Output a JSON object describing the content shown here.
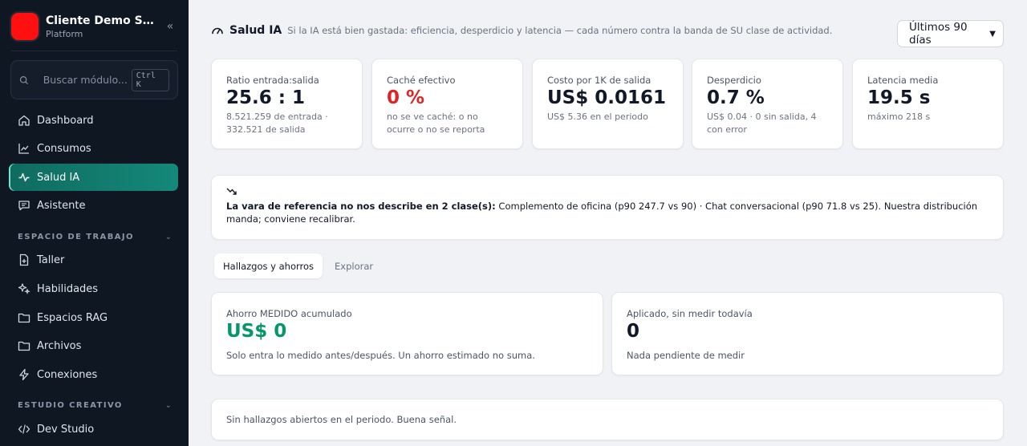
{
  "app": {
    "title": "Cliente Demo SI...",
    "subtitle": "Platform",
    "collapse_glyph": "«"
  },
  "search": {
    "placeholder": "Buscar módulo...",
    "shortcut": "Ctrl K"
  },
  "sidebar": {
    "items": [
      {
        "label": "Dashboard",
        "icon": "home-icon"
      },
      {
        "label": "Consumos",
        "icon": "line-chart-icon"
      },
      {
        "label": "Salud IA",
        "icon": "pulse-icon",
        "active": true
      },
      {
        "label": "Asistente",
        "icon": "chat-icon"
      }
    ],
    "sections": [
      {
        "label": "ESPACIO DE TRABAJO",
        "items": [
          {
            "label": "Taller",
            "icon": "file-plus-icon"
          },
          {
            "label": "Habilidades",
            "icon": "sparkles-icon"
          },
          {
            "label": "Espacios RAG",
            "icon": "folder-icon"
          },
          {
            "label": "Archivos",
            "icon": "folder-icon"
          },
          {
            "label": "Conexiones",
            "icon": "bolt-icon"
          }
        ]
      },
      {
        "label": "ESTUDIO CREATIVO",
        "items": [
          {
            "label": "Dev Studio",
            "icon": "code-icon"
          }
        ]
      }
    ]
  },
  "header": {
    "title": "Salud IA",
    "subtitle": "Si la IA está bien gastada: eficiencia, desperdicio y latencia — cada número contra la banda de SU clase de actividad.",
    "period": "Últimos 90 días"
  },
  "kpis": [
    {
      "label": "Ratio entrada:salida",
      "value": "25.6 : 1",
      "note": "8.521.259 de entrada · 332.521 de salida"
    },
    {
      "label": "Caché efectivo",
      "value": "0 %",
      "note": "no se ve caché: o no ocurre o no se reporta",
      "accent": "#dc2626"
    },
    {
      "label": "Costo por 1K de salida",
      "value": "US$ 0.0161",
      "note": "US$ 5.36 en el periodo"
    },
    {
      "label": "Desperdicio",
      "value": "0.7 %",
      "note": "US$ 0.04 · 0 sin salida, 4 con error"
    },
    {
      "label": "Latencia media",
      "value": "19.5 s",
      "note": "máximo 218 s"
    }
  ],
  "alert": {
    "icon": "trend-down-icon",
    "bold": "La vara de referencia no nos describe en 2 clase(s):",
    "text": " Complemento de oficina (p90 247.7 vs 90) · Chat conversacional (p90 71.8 vs 25). Nuestra distribución manda; conviene recalibrar."
  },
  "tabs": [
    {
      "label": "Hallazgos y ahorros",
      "active": true
    },
    {
      "label": "Explorar"
    }
  ],
  "savings": [
    {
      "label": "Ahorro MEDIDO acumulado",
      "value": "US$ 0",
      "note": "Solo entra lo medido antes/después. Un ahorro estimado no suma.",
      "accent": "#059669"
    },
    {
      "label": "Aplicado, sin medir todavía",
      "value": "0",
      "note": "Nada pendiente de medir"
    }
  ],
  "empty_message": "Sin hallazgos abiertos en el periodo. Buena señal."
}
